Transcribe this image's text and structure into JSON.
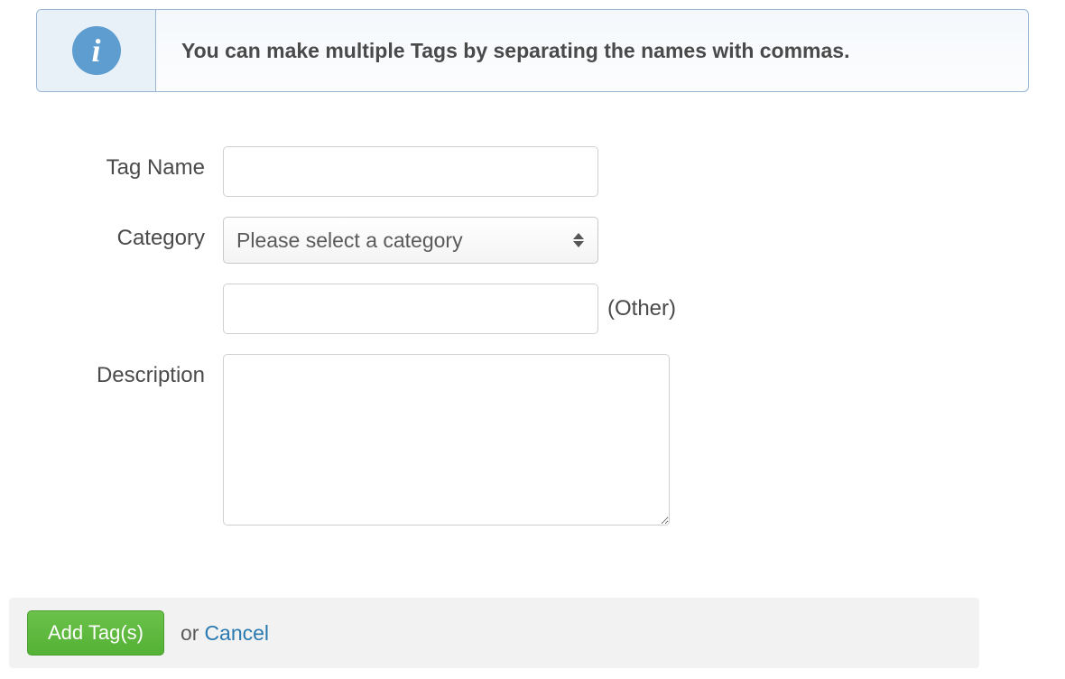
{
  "info": {
    "message": "You can make multiple Tags by separating the names with commas."
  },
  "form": {
    "tag_name": {
      "label": "Tag Name",
      "value": ""
    },
    "category": {
      "label": "Category",
      "placeholder": "Please select a category",
      "selected_value": ""
    },
    "other": {
      "label": "(Other)",
      "value": ""
    },
    "description": {
      "label": "Description",
      "value": ""
    }
  },
  "actions": {
    "add_label": "Add Tag(s)",
    "or_text": "or",
    "cancel_label": "Cancel"
  }
}
